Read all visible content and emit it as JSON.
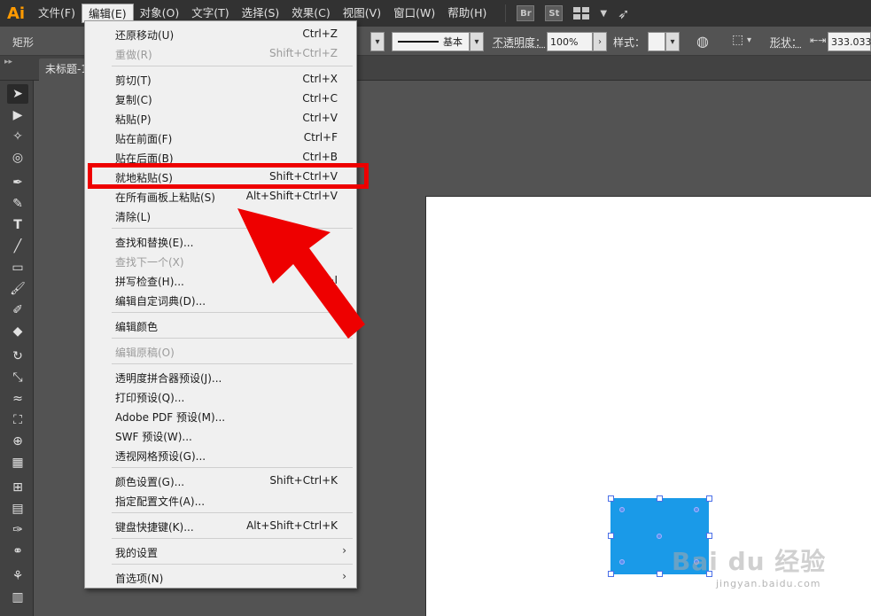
{
  "app": {
    "logo": "Ai"
  },
  "menubar": {
    "items": [
      "文件(F)",
      "编辑(E)",
      "对象(O)",
      "文字(T)",
      "选择(S)",
      "效果(C)",
      "视图(V)",
      "窗口(W)",
      "帮助(H)"
    ],
    "active_index": 1,
    "badges": [
      "Br",
      "St"
    ]
  },
  "controlbar": {
    "tool_name": "矩形",
    "stroke_style_label": "基本",
    "opacity_label": "不透明度：",
    "opacity_value": "100%",
    "style_label": "样式：",
    "shape_label": "形状：",
    "width_value": "333.033"
  },
  "document": {
    "tab_title": "未标题-1"
  },
  "edit_menu": {
    "items": [
      {
        "label": "还原移动(U)",
        "shortcut": "Ctrl+Z",
        "disabled": false
      },
      {
        "label": "重做(R)",
        "shortcut": "Shift+Ctrl+Z",
        "disabled": true
      },
      {
        "label": "剪切(T)",
        "shortcut": "Ctrl+X",
        "disabled": false
      },
      {
        "label": "复制(C)",
        "shortcut": "Ctrl+C",
        "disabled": false
      },
      {
        "label": "粘贴(P)",
        "shortcut": "Ctrl+V",
        "disabled": false
      },
      {
        "label": "贴在前面(F)",
        "shortcut": "Ctrl+F",
        "disabled": false
      },
      {
        "label": "贴在后面(B)",
        "shortcut": "Ctrl+B",
        "disabled": false
      },
      {
        "label": "就地粘贴(S)",
        "shortcut": "Shift+Ctrl+V",
        "disabled": false
      },
      {
        "label": "在所有画板上粘贴(S)",
        "shortcut": "Alt+Shift+Ctrl+V",
        "disabled": false
      },
      {
        "label": "清除(L)",
        "shortcut": "",
        "disabled": false
      },
      {
        "label": "查找和替换(E)...",
        "shortcut": "",
        "disabled": false
      },
      {
        "label": "查找下一个(X)",
        "shortcut": "",
        "disabled": true
      },
      {
        "label": "拼写检查(H)...",
        "shortcut": "Ctrl+I",
        "disabled": false
      },
      {
        "label": "编辑自定词典(D)...",
        "shortcut": "",
        "disabled": false
      },
      {
        "label": "编辑颜色",
        "shortcut": "",
        "disabled": false
      },
      {
        "label": "编辑原稿(O)",
        "shortcut": "",
        "disabled": true
      },
      {
        "label": "透明度拼合器预设(J)...",
        "shortcut": "",
        "disabled": false
      },
      {
        "label": "打印预设(Q)...",
        "shortcut": "",
        "disabled": false
      },
      {
        "label": "Adobe PDF 预设(M)...",
        "shortcut": "",
        "disabled": false
      },
      {
        "label": "SWF 预设(W)...",
        "shortcut": "",
        "disabled": false
      },
      {
        "label": "透视网格预设(G)...",
        "shortcut": "",
        "disabled": false
      },
      {
        "label": "颜色设置(G)...",
        "shortcut": "Shift+Ctrl+K",
        "disabled": false
      },
      {
        "label": "指定配置文件(A)...",
        "shortcut": "",
        "disabled": false
      },
      {
        "label": "键盘快捷键(K)...",
        "shortcut": "Alt+Shift+Ctrl+K",
        "disabled": false
      },
      {
        "label": "我的设置",
        "shortcut": "",
        "disabled": false,
        "submenu": true
      },
      {
        "label": "首选项(N)",
        "shortcut": "",
        "disabled": false,
        "submenu": true
      }
    ]
  },
  "canvas": {
    "rect_color": "#1a9ae8"
  },
  "watermark": {
    "main": "Bai du 经验",
    "sub": "jingyan.baidu.com"
  },
  "colors": {
    "highlight": "#ee0000",
    "menu_bg": "#f0f0f0",
    "app_bg": "#535353"
  }
}
